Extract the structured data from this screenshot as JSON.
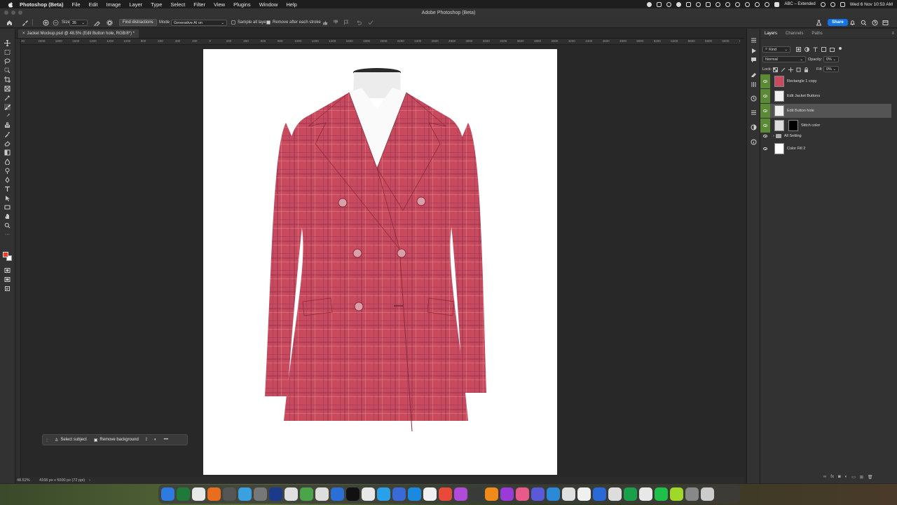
{
  "menubar": {
    "app_name": "Photoshop (Beta)",
    "items": [
      "File",
      "Edit",
      "Image",
      "Layer",
      "Type",
      "Select",
      "Filter",
      "View",
      "Plugins",
      "Window",
      "Help"
    ],
    "input_source": "ABC – Extended",
    "datetime": "Wed 6 Nov  10:53 AM"
  },
  "window": {
    "title": "Adobe Photoshop (Beta)"
  },
  "options": {
    "size_label": "Size:",
    "size_value": "35",
    "find_distractions": "Find distractions",
    "mode_label": "Mode",
    "mode_value": "Generative AI on",
    "sample_all_layers": "Sample all layers",
    "sample_all_layers_checked": false,
    "remove_after_stroke": "Remove after each stroke",
    "remove_after_stroke_checked": true,
    "share": "Share"
  },
  "document": {
    "tab_title": "Jacket Mockup.psd @ 48.5% (Edit Button hole, RGB/8*) *"
  },
  "ruler": {
    "ticks": [
      "20",
      "2000",
      "1800",
      "1600",
      "1400",
      "1200",
      "1000",
      "800",
      "600",
      "400",
      "200",
      "0",
      "200",
      "400",
      "600",
      "800",
      "1000",
      "1200",
      "1400",
      "1600",
      "1800",
      "2000",
      "2200",
      "2400",
      "2600",
      "2800",
      "3000",
      "3200",
      "3400",
      "3600",
      "3800",
      "4000",
      "4200",
      "4400",
      "4600",
      "4800",
      "5000",
      "5200",
      "5400",
      "5600",
      "5800",
      "6000",
      "6200"
    ]
  },
  "context_bar": {
    "select_subject": "Select subject",
    "remove_background": "Remove background",
    "more": "•••"
  },
  "status": {
    "zoom": "48.52%",
    "doc_info": "4168 px x 5000 px (72 ppi)"
  },
  "layers_panel": {
    "tabs": [
      "Layers",
      "Channels",
      "Paths"
    ],
    "filter_kind": "Kind",
    "blend_mode": "Normal",
    "opacity_label": "Opacity:",
    "opacity_value": "0%",
    "lock_label": "Lock:",
    "fill_label": "Fill:",
    "fill_value": "0%",
    "layers": [
      {
        "name": "Rectangle 1 copy",
        "selected": false
      },
      {
        "name": "Edit Jacket Buttons",
        "selected": false
      },
      {
        "name": "Edit Button hole",
        "selected": true
      },
      {
        "name": "Stitch color",
        "selected": false
      },
      {
        "name": "All Setting",
        "selected": false
      },
      {
        "name": "Color Fill 2",
        "selected": false
      }
    ]
  },
  "colors": {
    "jacket": "#c94a5c",
    "accent": "#1473e6",
    "visible_group": "#5a8a34",
    "foreground": "#e8402a",
    "background": "#ffffff"
  }
}
